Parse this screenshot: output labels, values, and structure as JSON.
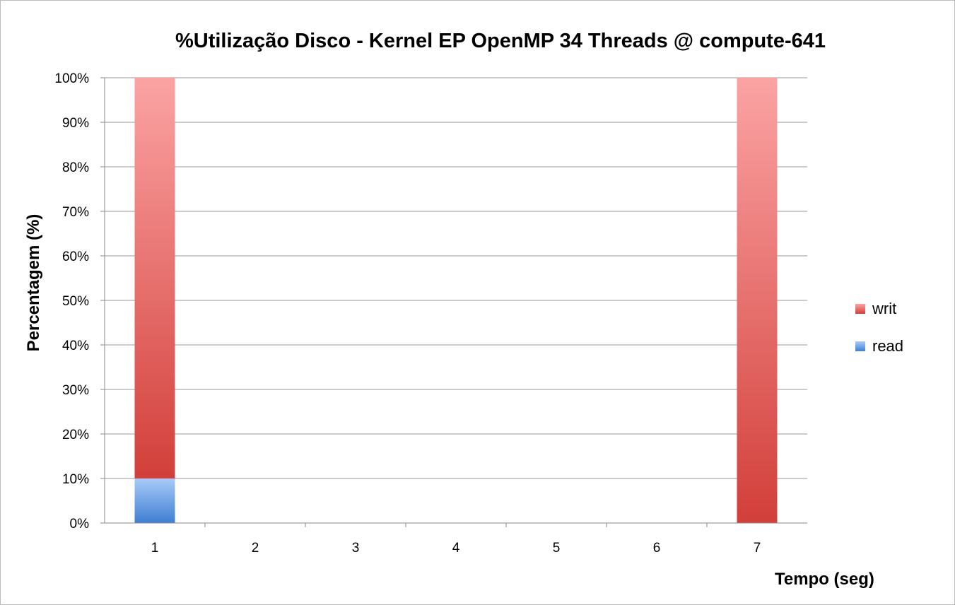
{
  "chart_data": {
    "type": "bar",
    "stacked": true,
    "title": "%Utilização Disco - Kernel EP OpenMP 34 Threads  @ compute-641",
    "xlabel": "Tempo (seg)",
    "ylabel": "Percentagem (%)",
    "categories": [
      "1",
      "2",
      "3",
      "4",
      "5",
      "6",
      "7"
    ],
    "ylim": [
      0,
      100
    ],
    "yticks": [
      "0%",
      "10%",
      "20%",
      "30%",
      "40%",
      "50%",
      "60%",
      "70%",
      "80%",
      "90%",
      "100%"
    ],
    "grid": true,
    "legend_position": "right",
    "series": [
      {
        "name": "read",
        "values": [
          10,
          0,
          0,
          0,
          0,
          0,
          0
        ],
        "color": "#4a86d4"
      },
      {
        "name": "writ",
        "values": [
          90,
          0,
          0,
          0,
          0,
          0,
          100
        ],
        "color": "#d9413d"
      }
    ]
  },
  "legend": {
    "writ_label": "writ",
    "read_label": "read"
  }
}
